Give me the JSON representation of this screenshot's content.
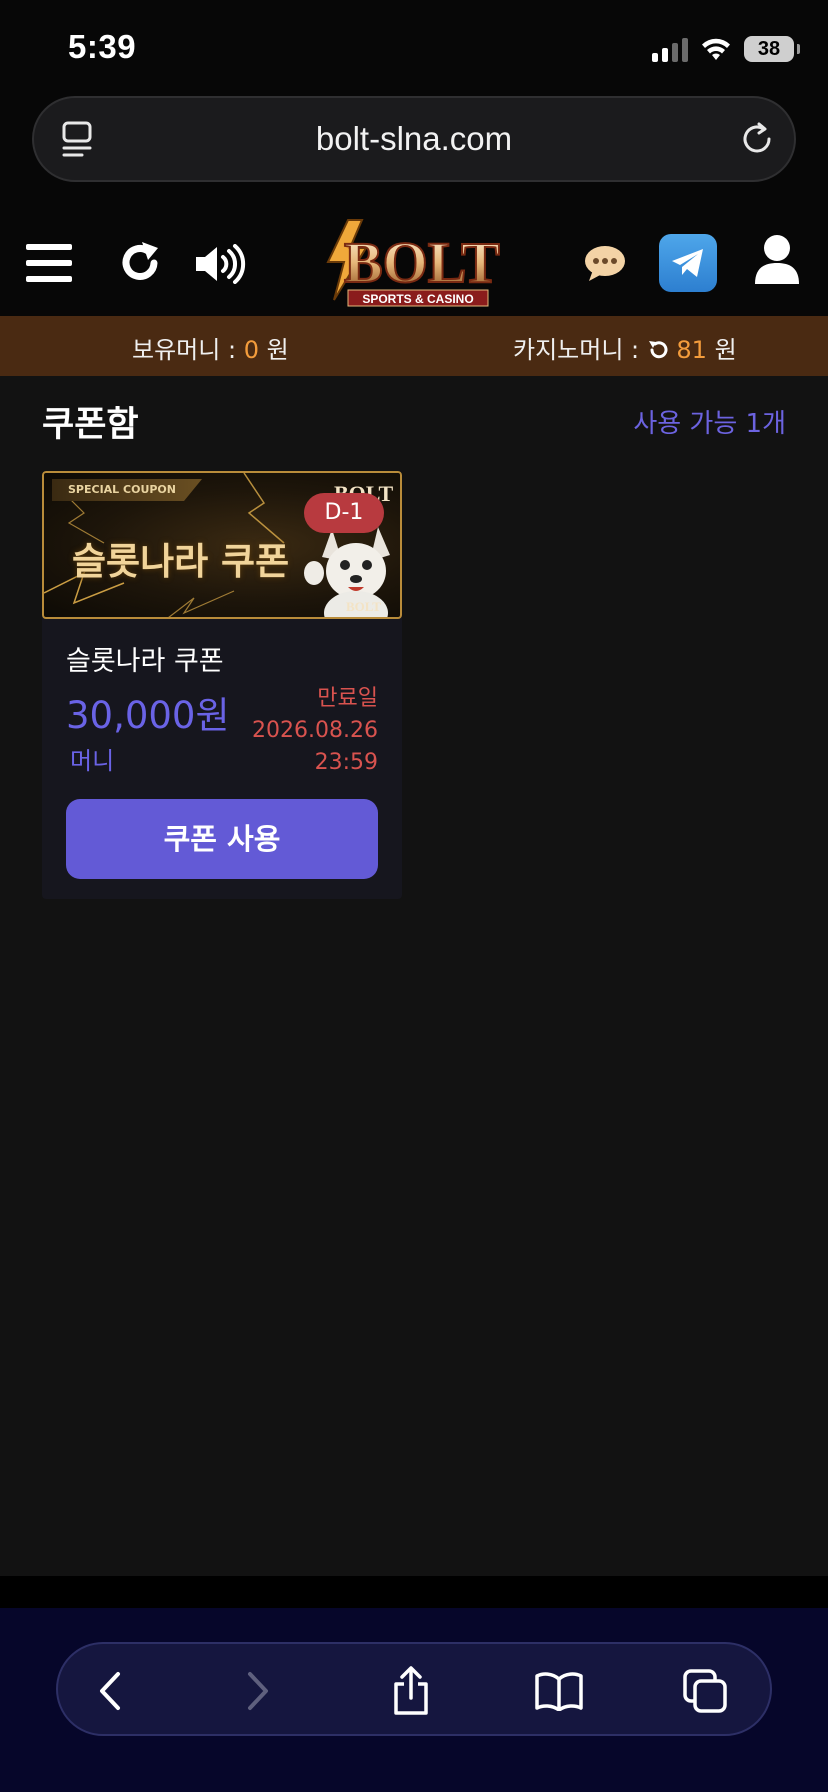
{
  "status_bar": {
    "time": "5:39",
    "battery": "38"
  },
  "browser": {
    "url": "bolt-slna.com"
  },
  "header": {
    "logo_text": "BOLT",
    "logo_subtitle": "SPORTS & CASINO"
  },
  "balance": {
    "hold_label": "보유머니 :",
    "hold_value": "0",
    "hold_unit": "원",
    "casino_label": "카지노머니 :",
    "casino_value": "81",
    "casino_unit": "원"
  },
  "section": {
    "title": "쿠폰함",
    "available": "사용 가능 1개"
  },
  "coupon": {
    "banner_tag": "SPECIAL COUPON",
    "banner_title": "슬롯나라 쿠폰",
    "dday": "D-1",
    "name": "슬롯나라 쿠폰",
    "amount": "30,000원",
    "unit": "머니",
    "expiry_label": "만료일",
    "expiry_date": "2026.08.26",
    "expiry_time": "23:59",
    "use_button": "쿠폰 사용"
  },
  "colors": {
    "accent": "#635ad6",
    "orange": "#f39c3c",
    "expiry": "#d9534f",
    "balance_bar": "#4a2a12"
  }
}
